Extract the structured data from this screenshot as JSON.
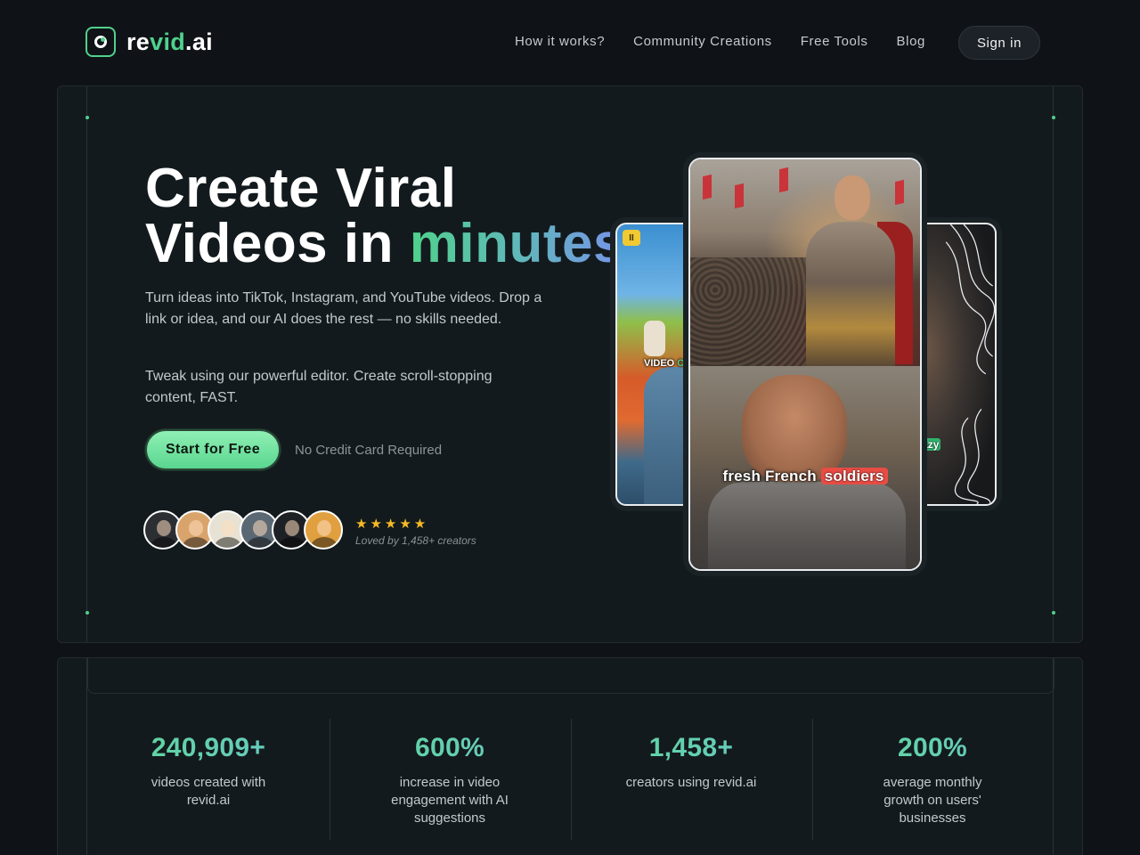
{
  "brand": {
    "name_prefix": "re",
    "name_accent": "vid",
    "name_suffix": ".ai",
    "accent_color": "#4fd18b"
  },
  "nav": {
    "links": [
      "How it works?",
      "Community Creations",
      "Free Tools",
      "Blog"
    ],
    "signin_label": "Sign in"
  },
  "hero": {
    "headline_line1": "Create Viral",
    "headline_line2_prefix": "Videos in ",
    "headline_highlight": "minutes!",
    "description1": "Turn ideas into TikTok, Instagram, and YouTube videos. Drop a link or idea, and our AI does the rest — no skills needed.",
    "description2": "Tweak using our powerful editor. Create scroll-stopping content, FAST.",
    "cta_label": "Start for Free",
    "cta_note": "No Credit Card Required",
    "rating_stars": "★★★★★",
    "loved_by": "Loved by 1,458+ creators",
    "avatar_colors": [
      "#2b2f33",
      "#d9a46c",
      "#e7e2d3",
      "#5a6874",
      "#1d2024",
      "#e1a040"
    ]
  },
  "cards": {
    "left": {
      "badge": "II",
      "caption_prefix": "VIDEO ",
      "caption_highlight": "CR"
    },
    "main": {
      "caption_prefix": "fresh French ",
      "caption_highlight": "soldiers"
    },
    "right": {
      "caption_prefix": "g ",
      "caption_highlight": "crazy"
    }
  },
  "stats": [
    {
      "value": "240,909+",
      "label": "videos created with revid.ai"
    },
    {
      "value": "600%",
      "label": "increase in video engagement with AI suggestions"
    },
    {
      "value": "1,458+",
      "label": "creators using revid.ai"
    },
    {
      "value": "200%",
      "label": "average monthly growth on users' businesses"
    }
  ]
}
